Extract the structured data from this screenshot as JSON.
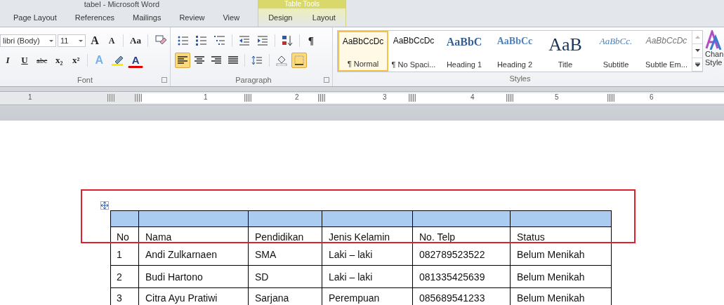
{
  "window": {
    "title": "tabel - Microsoft Word"
  },
  "tabs": [
    {
      "label": "Page Layout",
      "selected": false
    },
    {
      "label": "References",
      "selected": false
    },
    {
      "label": "Mailings",
      "selected": false
    },
    {
      "label": "Review",
      "selected": false
    },
    {
      "label": "View",
      "selected": false
    }
  ],
  "contextual_group": {
    "label": "Table Tools",
    "tabs": [
      {
        "label": "Design",
        "selected": false
      },
      {
        "label": "Layout",
        "selected": false
      }
    ]
  },
  "font_group": {
    "label": "Font",
    "font_name": "libri (Body)",
    "font_size": "11",
    "row1": [
      {
        "kind": "grow",
        "glyph": "A"
      },
      {
        "kind": "shrink",
        "glyph": "A"
      },
      {
        "kind": "sep"
      },
      {
        "kind": "case",
        "glyph": "Aa"
      },
      {
        "kind": "sep"
      },
      {
        "kind": "clear"
      }
    ],
    "row2": [
      {
        "kind": "italic",
        "glyph": "I"
      },
      {
        "kind": "underline",
        "glyph": "U"
      },
      {
        "kind": "strike",
        "glyph": "abc"
      },
      {
        "kind": "sub",
        "glyph": "x₂"
      },
      {
        "kind": "sup",
        "glyph": "x²"
      },
      {
        "kind": "sep"
      },
      {
        "kind": "effects",
        "glyph": "A"
      },
      {
        "kind": "highlight"
      },
      {
        "kind": "color",
        "glyph": "A"
      }
    ]
  },
  "paragraph_group": {
    "label": "Paragraph",
    "row1": [
      {
        "kind": "bullets",
        "selected": false
      },
      {
        "kind": "numbering",
        "selected": false
      },
      {
        "kind": "multilevel",
        "selected": false
      },
      {
        "kind": "sep"
      },
      {
        "kind": "outdent",
        "selected": false
      },
      {
        "kind": "indent",
        "selected": false
      },
      {
        "kind": "sep"
      },
      {
        "kind": "sort",
        "selected": false
      },
      {
        "kind": "sep"
      },
      {
        "kind": "pilcrow",
        "glyph": "¶",
        "selected": false
      }
    ],
    "row2": [
      {
        "kind": "align-left",
        "selected": true
      },
      {
        "kind": "align-center",
        "selected": false
      },
      {
        "kind": "align-right",
        "selected": false
      },
      {
        "kind": "justify",
        "selected": false
      },
      {
        "kind": "sep"
      },
      {
        "kind": "spacing",
        "selected": false
      },
      {
        "kind": "sep"
      },
      {
        "kind": "shading",
        "selected": false
      },
      {
        "kind": "borders",
        "selected": true
      }
    ]
  },
  "styles_group": {
    "label": "Styles",
    "items": [
      {
        "preview": "AaBbCcDc",
        "label": "¶ Normal",
        "kind": "normal",
        "selected": true
      },
      {
        "preview": "AaBbCcDc",
        "label": "¶ No Spaci...",
        "kind": "normal",
        "selected": false
      },
      {
        "preview": "AaBbC",
        "label": "Heading 1",
        "kind": "heading1",
        "selected": false
      },
      {
        "preview": "AaBbCc",
        "label": "Heading 2",
        "kind": "heading2",
        "selected": false
      },
      {
        "preview": "AaB",
        "label": "Title",
        "kind": "title",
        "selected": false
      },
      {
        "preview": "AaBbCc.",
        "label": "Subtitle",
        "kind": "subtitle",
        "selected": false
      },
      {
        "preview": "AaBbCcDc",
        "label": "Subtle Em...",
        "kind": "subtle",
        "selected": false
      }
    ],
    "change_styles": [
      "Chan",
      "Style"
    ]
  },
  "ruler": [
    "1",
    "1",
    "2",
    "3",
    "4",
    "5",
    "6"
  ],
  "table": {
    "header": [
      "No",
      "Nama",
      "Pendidikan",
      "Jenis Kelamin",
      "No. Telp",
      "Status"
    ],
    "rows": [
      [
        "1",
        "Andi Zulkarnaen",
        "SMA",
        "Laki – laki",
        "082789523522",
        "Belum Menikah"
      ],
      [
        "2",
        "Budi Hartono",
        "SD",
        "Laki – laki",
        "081335425639",
        "Belum Menikah"
      ],
      [
        "3",
        "Citra Ayu Pratiwi",
        "Sarjana",
        "Perempuan",
        "085689541233",
        "Belum Menikah"
      ]
    ]
  }
}
